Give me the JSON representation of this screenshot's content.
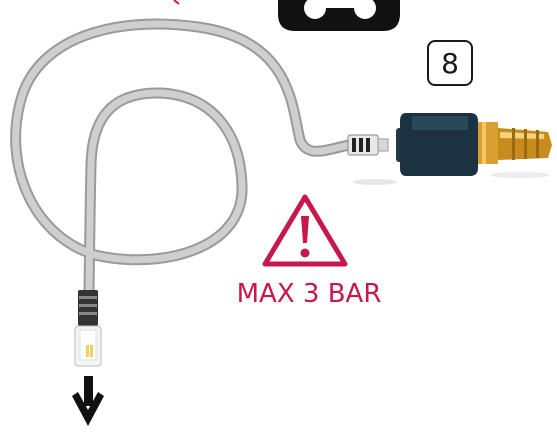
{
  "step": {
    "number": "8"
  },
  "warning": {
    "text": "MAX 3 BAR"
  },
  "colors": {
    "warning": "#c8174b",
    "cable": "#c4c4c4",
    "fitting_body": "#1c3240",
    "brass": "#d9a030",
    "arrow": "#111111"
  },
  "icons": {
    "warning": "warning-triangle-icon",
    "direction": "arrow-down-icon",
    "top_device": "device-icon"
  }
}
